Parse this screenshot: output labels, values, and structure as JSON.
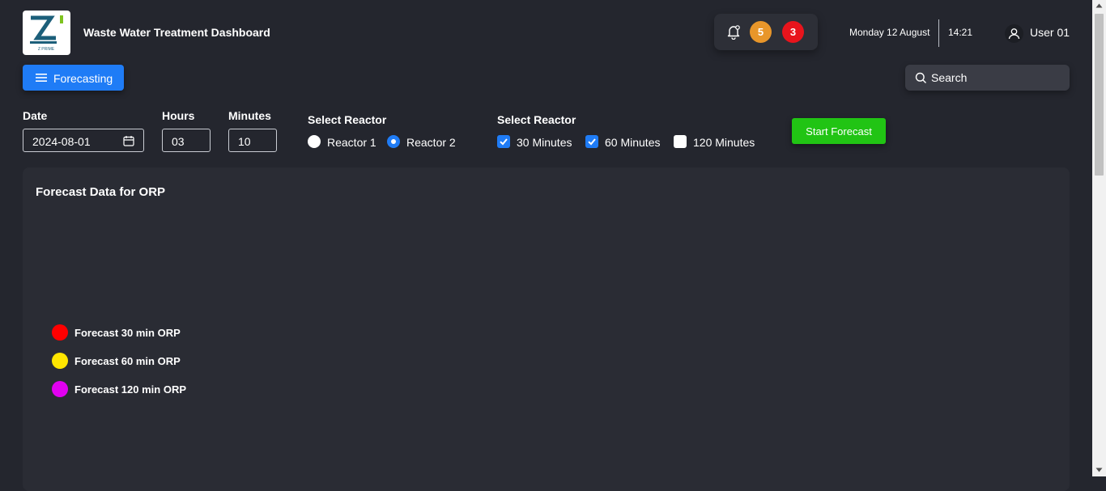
{
  "header": {
    "title": "Waste Water Treatment Dashboard",
    "logo_text": "Z PRIME",
    "notifications": {
      "warning_count": "5",
      "alert_count": "3"
    },
    "date": "Monday 12 August",
    "time": "14:21",
    "user": "User 01"
  },
  "nav": {
    "menu_label": "Forecasting"
  },
  "search": {
    "placeholder": "Search"
  },
  "form": {
    "date_label": "Date",
    "date_value": "2024-08-01",
    "hours_label": "Hours",
    "hours_value": "03",
    "minutes_label": "Minutes",
    "minutes_value": "10",
    "reactor_label": "Select Reactor",
    "reactors": [
      {
        "label": "Reactor 1",
        "selected": false
      },
      {
        "label": "Reactor 2",
        "selected": true
      }
    ],
    "interval_label": "Select Reactor",
    "intervals": [
      {
        "label": "30 Minutes",
        "checked": true
      },
      {
        "label": "60 Minutes",
        "checked": true
      },
      {
        "label": "120 Minutes",
        "checked": false
      }
    ],
    "start_label": "Start Forecast"
  },
  "panel": {
    "title": "Forecast Data for ORP",
    "legend": [
      {
        "label": "Forecast 30 min ORP",
        "color": "#ff0000"
      },
      {
        "label": "Forecast 60 min ORP",
        "color": "#ffe600"
      },
      {
        "label": "Forecast 120 min ORP",
        "color": "#e100f0"
      }
    ]
  },
  "colors": {
    "background": "#24262e",
    "primary": "#1f7cf6",
    "success": "#21c414",
    "warning_badge": "#e8962a",
    "alert_badge": "#e8141c"
  }
}
